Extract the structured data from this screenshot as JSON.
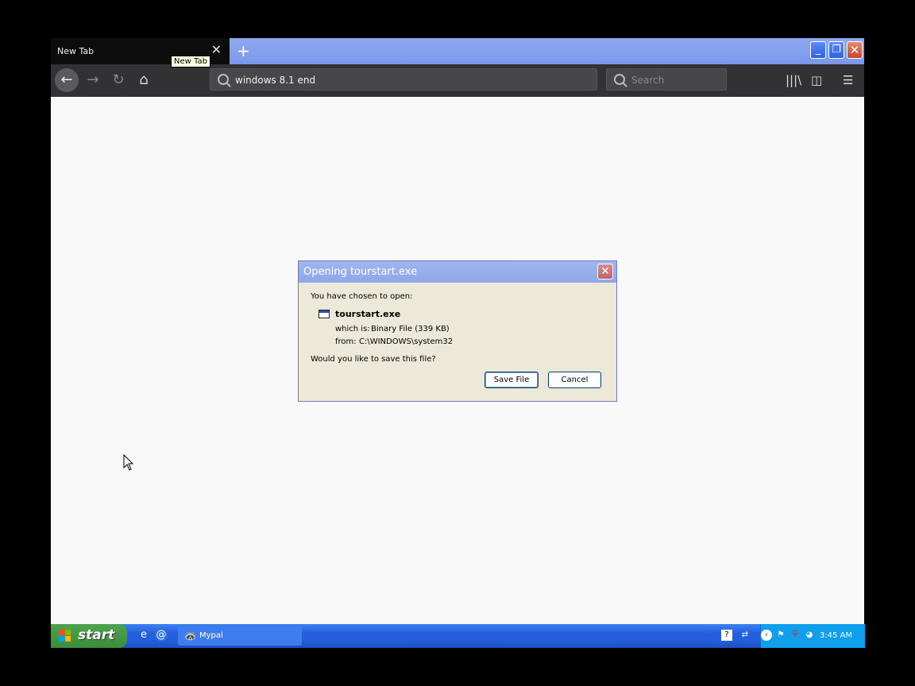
{
  "browser": {
    "tab_title": "New Tab",
    "tab_tooltip": "New Tab",
    "new_tab_icon": "plus-icon",
    "url": "windows 8.1 end",
    "search_placeholder": "Search"
  },
  "dialog": {
    "title": "Opening tourstart.exe",
    "intro": "You have chosen to open:",
    "file_name": "tourstart.exe",
    "which_is_label": "which is:",
    "which_is_value": "Binary File (339 KB)",
    "from_label": "from:",
    "from_value": "C:\\WINDOWS\\system32",
    "question": "Would you like to save this file?",
    "save_label": "Save File",
    "cancel_label": "Cancel"
  },
  "taskbar": {
    "start_label": "start",
    "task_label": "Mypal",
    "clock": "3:45 AM"
  },
  "colors": {
    "taskbar_blue": "#245edb",
    "start_green": "#3c8c3c",
    "dialog_bg": "#ece9d8",
    "toolbar_dark": "#323234"
  }
}
